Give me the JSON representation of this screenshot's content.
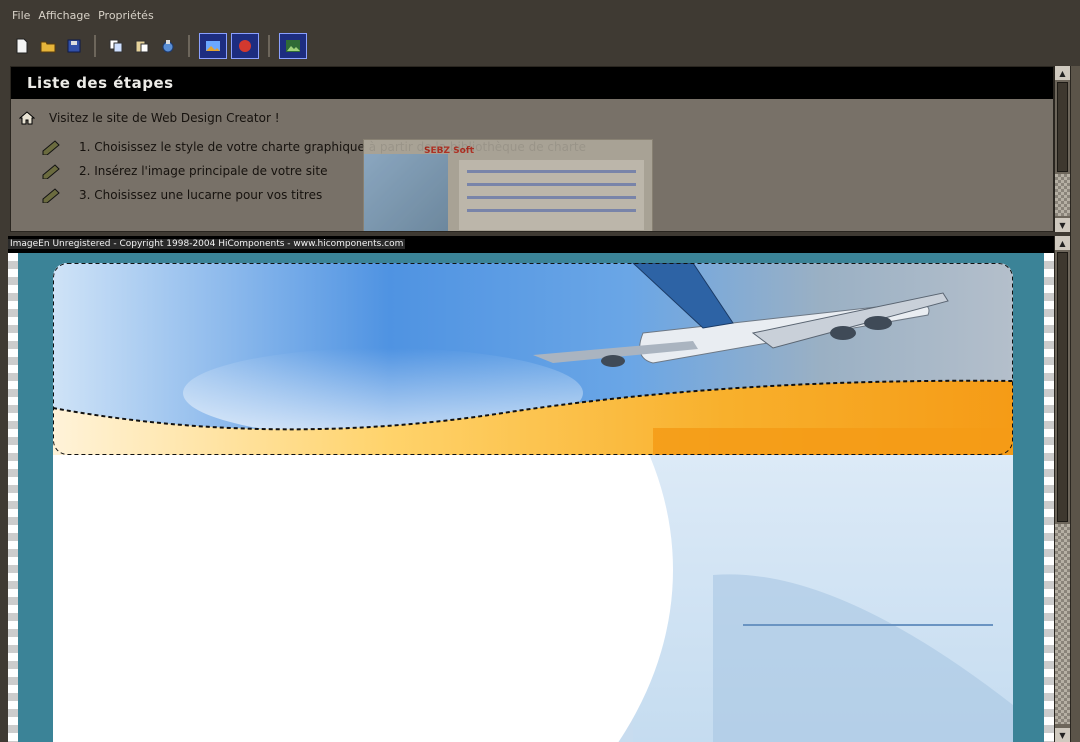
{
  "menu": {
    "items": [
      "File",
      "Affichage",
      "Propriétés"
    ]
  },
  "toolbar": {
    "buttons": [
      "new-file-icon",
      "open-folder-icon",
      "save-disk-icon",
      "copy-icon",
      "paste-icon",
      "export-icon",
      "image-icon",
      "clipart-icon",
      "preview-icon"
    ]
  },
  "steps_panel": {
    "title": "Liste des étapes",
    "visit_link": "Visitez le site de Web Design Creator !",
    "steps": [
      "1. Choisissez le style de votre charte graphique à partir de la bibliothèque de charte",
      "2. Insérez l'image principale de votre site",
      "3. Choisissez une lucarne pour vos titres"
    ],
    "popup_logo": "SEBZ Soft"
  },
  "canvas": {
    "watermark": "ImageEn Unregistered - Copyright 1998-2004 HiComponents - www.hicomponents.com"
  },
  "colors": {
    "background": "#3f3a33",
    "canvas_teal": "#3b8397",
    "orange_wave": "#f7a51d",
    "sky_blue": "#5b9bdb"
  }
}
